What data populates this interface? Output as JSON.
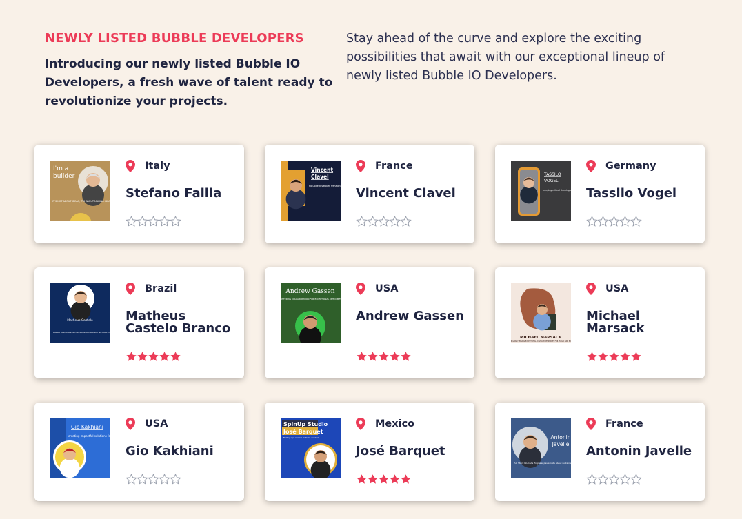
{
  "header": {
    "eyebrow": "NEWLY LISTED BUBBLE DEVELOPERS",
    "intro": "Introducing our newly listed Bubble IO Developers, a fresh wave of talent ready to revolutionize your projects.",
    "description": "Stay ahead of the curve and explore the exciting possibilities that await with our exceptional lineup of newly listed Bubble IO Developers."
  },
  "colors": {
    "accent": "#ec3b57",
    "background": "#f9f1e8",
    "text": "#1f2440"
  },
  "developers": [
    {
      "name": "Stefano Failla",
      "country": "Italy",
      "rating": 0,
      "thumb_text": [
        "I'm a",
        "builder",
        "IT'S NOT ABOUT IDEAS, IT'S ABOUT MAKING IDEAS HAPPEN"
      ]
    },
    {
      "name": "Vincent Clavel",
      "country": "France",
      "rating": 0,
      "thumb_text": [
        "Vincent",
        "Clavel",
        "No-Code developer reshaping digital presence of nonprofits and companies"
      ]
    },
    {
      "name": "Tassilo Vogel",
      "country": "Germany",
      "rating": 0,
      "thumb_text": [
        "TASSILO",
        "VOGEL",
        "merging critical thinking and quantitative skills with a visionary perspective"
      ]
    },
    {
      "name": "Matheus Castelo Branco",
      "country": "Brazil",
      "rating": 5,
      "thumb_text": [
        "Matheus Castelo",
        "BUBBLE DEVELOPER MATHEUS CASTELO BRANCO: NO-CODE EXPERTISE AND SOFTWARE INNOVATION"
      ]
    },
    {
      "name": "Andrew Gassen",
      "country": "USA",
      "rating": 5,
      "thumb_text": [
        "Andrew Gassen",
        "FOSTERING COLLABORATION FOR EXCEPTIONAL OUTCOMES"
      ]
    },
    {
      "name": "Michael Marsack",
      "country": "USA",
      "rating": 5,
      "thumb_text": [
        "MICHAEL MARSACK",
        "BUILDING AND SELLING EXCEPTIONAL DIGITAL EXPERIENCES FOR PUBLIC AND PRIVATE"
      ]
    },
    {
      "name": "Gio Kakhiani",
      "country": "USA",
      "rating": 0,
      "thumb_text": [
        "Gio Kakhiani",
        "creating impactful solutions for global challenges"
      ]
    },
    {
      "name": "José Barquet",
      "country": "Mexico",
      "rating": 5,
      "thumb_text": [
        "SpinUp Studio",
        "José Barquet",
        "Building apps and web platforms worldwide"
      ]
    },
    {
      "name": "Antonin Javelle",
      "country": "France",
      "rating": 0,
      "thumb_text": [
        "Antonin",
        "Javelle",
        "Full Stack No-Code Engineer passionate about sustainable agriculture and IT innovation"
      ]
    }
  ]
}
